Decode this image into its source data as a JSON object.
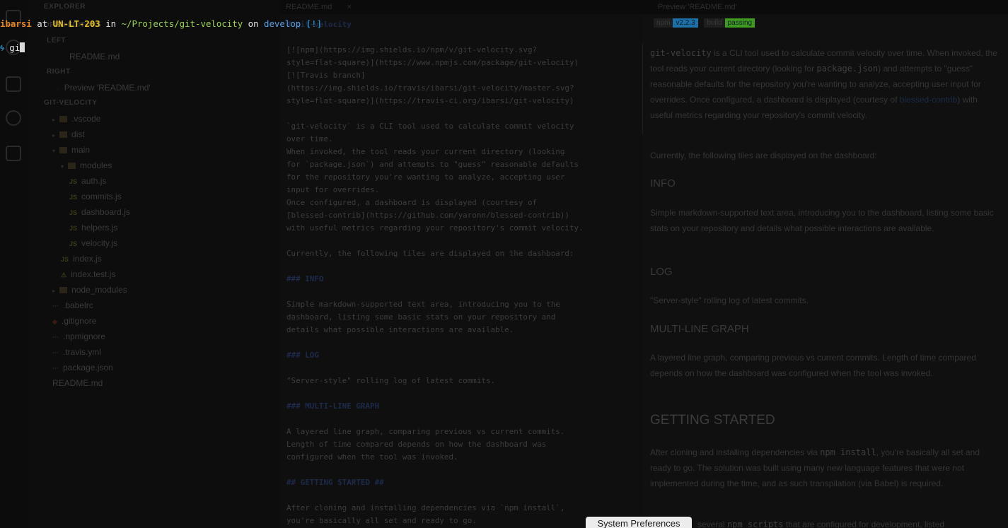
{
  "terminal": {
    "user": "ibarsi",
    "at": " at ",
    "host": "UN-LT-203",
    "in": " in ",
    "path": "~/Projects/git-velocity",
    "on": " on ",
    "branch": "develop",
    "status": " [!]",
    "prompt_icon": "cyclone-icon",
    "input": "gi",
    "colors": {
      "user": "#e6842a",
      "host": "#e6c02a",
      "path": "#9bd45a",
      "branch": "#5aa0e6",
      "status": "#29a3e0",
      "text": "#e8e8e8"
    }
  },
  "explorer": {
    "title": "EXPLORER",
    "open_editors": "OPEN EDITORS",
    "left_label": "LEFT",
    "left_file": "README.md",
    "right_label": "RIGHT",
    "right_file": "Preview 'README.md'",
    "project": "GIT-VELOCITY",
    "tree": [
      {
        "label": ".vscode",
        "indent": 1,
        "kind": "folder",
        "caret": "▸"
      },
      {
        "label": "dist",
        "indent": 1,
        "kind": "folder",
        "caret": "▸"
      },
      {
        "label": "main",
        "indent": 1,
        "kind": "folder",
        "caret": "▾"
      },
      {
        "label": "modules",
        "indent": 2,
        "kind": "folder",
        "caret": "▾"
      },
      {
        "label": "auth.js",
        "indent": 3,
        "kind": "js"
      },
      {
        "label": "commits.js",
        "indent": 3,
        "kind": "js"
      },
      {
        "label": "dashboard.js",
        "indent": 3,
        "kind": "js"
      },
      {
        "label": "helpers.js",
        "indent": 3,
        "kind": "js"
      },
      {
        "label": "velocity.js",
        "indent": 3,
        "kind": "js"
      },
      {
        "label": "index.js",
        "indent": 2,
        "kind": "js"
      },
      {
        "label": "index.test.js",
        "indent": 2,
        "kind": "warn"
      },
      {
        "label": "node_modules",
        "indent": 1,
        "kind": "folder",
        "caret": "▸"
      },
      {
        "label": ".babelrc",
        "indent": 1,
        "kind": "dots"
      },
      {
        "label": ".gitignore",
        "indent": 1,
        "kind": "git"
      },
      {
        "label": ".npmignore",
        "indent": 1,
        "kind": "dots"
      },
      {
        "label": ".travis.yml",
        "indent": 1,
        "kind": "dots"
      },
      {
        "label": "package.json",
        "indent": 1,
        "kind": "dots"
      },
      {
        "label": "README.md",
        "indent": 1,
        "kind": "plain"
      }
    ]
  },
  "editor": {
    "tab": "README.md",
    "close": "×",
    "lines": [
      {
        "t": "# git-velocity",
        "k": "h"
      },
      {
        "t": "",
        "k": ""
      },
      {
        "t": "[![npm](https://img.shields.io/npm/v/git-velocity.svg?",
        "k": ""
      },
      {
        "t": "style=flat-square)](https://www.npmjs.com/package/git-velocity)",
        "k": ""
      },
      {
        "t": "[![Travis branch]",
        "k": ""
      },
      {
        "t": "(https://img.shields.io/travis/ibarsi/git-velocity/master.svg?",
        "k": ""
      },
      {
        "t": "style=flat-square)](https://travis-ci.org/ibarsi/git-velocity)",
        "k": ""
      },
      {
        "t": "",
        "k": ""
      },
      {
        "t": "`git-velocity` is a CLI tool used to calculate commit velocity",
        "k": ""
      },
      {
        "t": "over time.",
        "k": ""
      },
      {
        "t": "When invoked, the tool reads your current directory (looking",
        "k": ""
      },
      {
        "t": "for `package.json`) and attempts to \"guess\" reasonable defaults",
        "k": ""
      },
      {
        "t": "for the repository you're wanting to analyze, accepting user",
        "k": ""
      },
      {
        "t": "input for overrides.",
        "k": ""
      },
      {
        "t": "Once configured, a dashboard is displayed (courtesy of",
        "k": ""
      },
      {
        "t": "[blessed-contrib](https://github.com/yaronn/blessed-contrib))",
        "k": ""
      },
      {
        "t": "with useful metrics regarding your repository's commit velocity.",
        "k": ""
      },
      {
        "t": "",
        "k": ""
      },
      {
        "t": "Currently, the following tiles are displayed on the dashboard:",
        "k": ""
      },
      {
        "t": "",
        "k": ""
      },
      {
        "t": "### INFO",
        "k": "h"
      },
      {
        "t": "",
        "k": ""
      },
      {
        "t": "Simple markdown-supported text area, introducing you to the",
        "k": ""
      },
      {
        "t": "dashboard, listing some basic stats on your repository and",
        "k": ""
      },
      {
        "t": "details what possible interactions are available.",
        "k": ""
      },
      {
        "t": "",
        "k": ""
      },
      {
        "t": "### LOG",
        "k": "h"
      },
      {
        "t": "",
        "k": ""
      },
      {
        "t": "\"Server-style\" rolling log of latest commits.",
        "k": ""
      },
      {
        "t": "",
        "k": ""
      },
      {
        "t": "### MULTI-LINE GRAPH",
        "k": "h"
      },
      {
        "t": "",
        "k": ""
      },
      {
        "t": "A layered line graph, comparing previous vs current commits.",
        "k": ""
      },
      {
        "t": "Length of time compared depends on how the dashboard was",
        "k": ""
      },
      {
        "t": "configured when the tool was invoked.",
        "k": ""
      },
      {
        "t": "",
        "k": ""
      },
      {
        "t": "## GETTING STARTED ##",
        "k": "h"
      },
      {
        "t": "",
        "k": ""
      },
      {
        "t": "After cloning and installing dependencies via `npm install`,",
        "k": ""
      },
      {
        "t": "you're basically all set and ready to go.",
        "k": ""
      }
    ]
  },
  "preview": {
    "tab": "Preview 'README.md'",
    "badge_npm_left": "npm",
    "badge_npm_right": "v2.2.3",
    "badge_build_left": "build",
    "badge_build_right": "passing",
    "intro_code": "git-velocity",
    "intro_1": " is a CLI tool used to calculate commit velocity over time. When invoked, the tool reads your current directory (looking for ",
    "intro_code2": "package.json",
    "intro_2": ") and attempts to \"guess\" reasonable defaults for the repository you're wanting to analyze, accepting user input for overrides. Once configured, a dashboard is displayed (courtesy of ",
    "intro_link": "blessed-contrib",
    "intro_3": ") with useful metrics regarding your repository's commit velocity.",
    "tiles": "Currently, the following tiles are displayed on the dashboard:",
    "info_h": "INFO",
    "info_p": "Simple markdown-supported text area, introducing you to the dashboard, listing some basic stats on your repository and details what possible interactions are available.",
    "log_h": "LOG",
    "log_p": "\"Server-style\" rolling log of latest commits.",
    "graph_h": "MULTI-LINE GRAPH",
    "graph_p": "A layered line graph, comparing previous vs current commits. Length of time compared depends on how the dashboard was configured when the tool was invoked.",
    "start_h": "GETTING STARTED",
    "start_p1": "After cloning and installing dependencies via ",
    "start_code": "npm install",
    "start_p2": ", you're basically all set and ready to go. The solution was built using many new language features that were not implemented during the time, and as such transpilation (via Babel) is required.",
    "bottom_p1": "several ",
    "bottom_code": "npm scripts",
    "bottom_p2": " that are configured for development, listed",
    "colors": {
      "npm_badge": "#1d6fa5",
      "build_badge": "#3f9b1f"
    }
  },
  "tooltip": "System Preferences"
}
